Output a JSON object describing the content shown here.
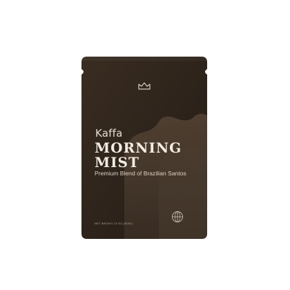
{
  "package": {
    "brand": "Kaffa",
    "product_name_line1": "MORNING",
    "product_name_line2": "MIST",
    "tagline": "Premium Blend of Brazilian Santos",
    "net_weight": "NET WEIGHT 12 OZ (340G)"
  },
  "icons": {
    "top_logo": "crown-icon",
    "bottom_badge": "globe-icon"
  },
  "colors": {
    "background": "#ffffff",
    "pouch_dark": "#2c2218",
    "pouch_mid": "#4a3b2e",
    "text_light": "#f3ece2"
  }
}
